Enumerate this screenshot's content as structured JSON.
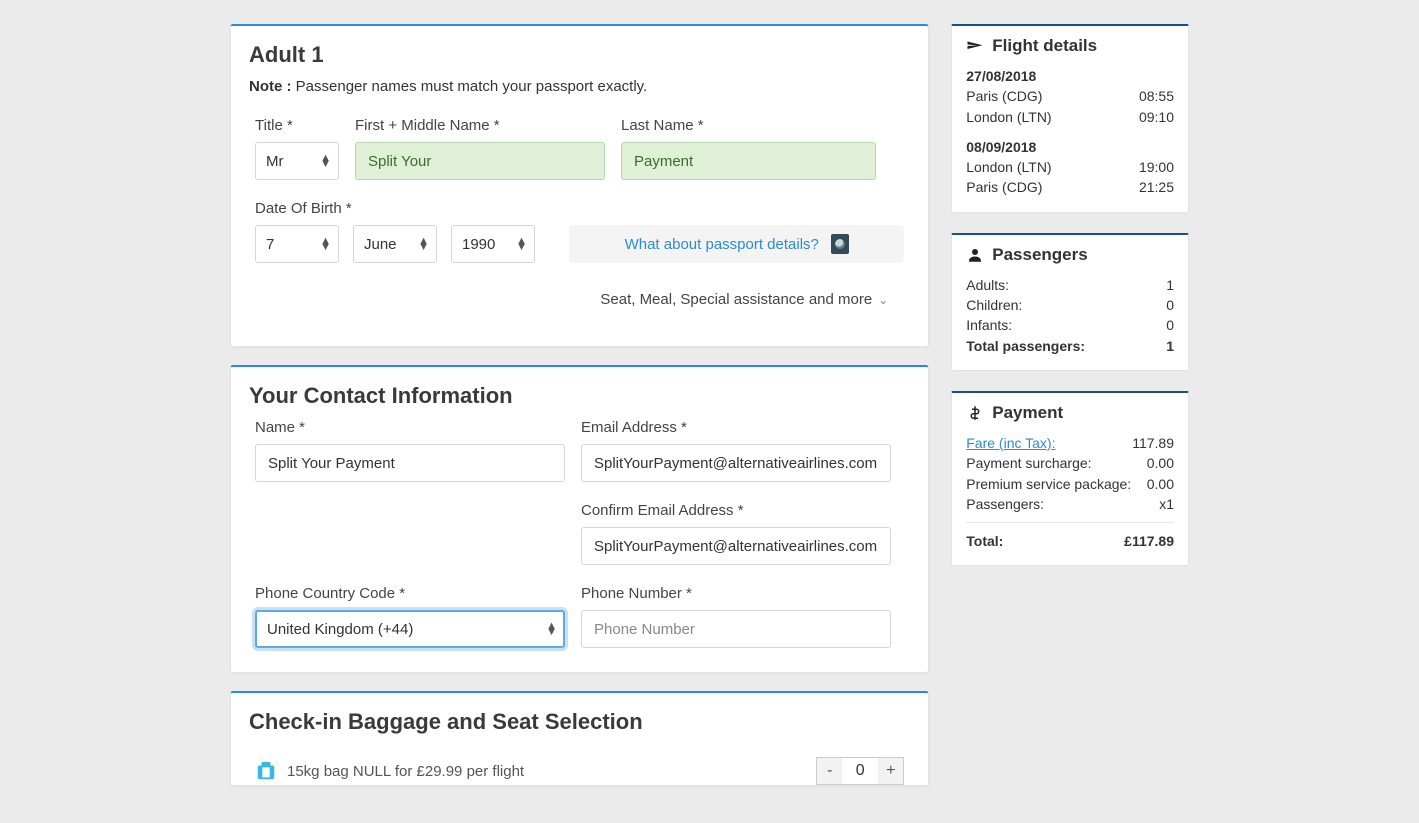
{
  "adult": {
    "heading": "Adult 1",
    "note_label": "Note :",
    "note_text": "Passenger names must match your passport exactly.",
    "title_label": "Title *",
    "title_value": "Mr",
    "first_label": "First + Middle Name *",
    "first_value": "Split Your",
    "last_label": "Last Name *",
    "last_value": "Payment",
    "dob_label": "Date Of Birth *",
    "dob_day": "7",
    "dob_month": "June",
    "dob_year": "1990",
    "passport_link": "What about passport details?",
    "expander": "Seat, Meal, Special assistance and more"
  },
  "contact": {
    "heading": "Your Contact Information",
    "name_label": "Name *",
    "name_value": "Split Your Payment",
    "email_label": "Email Address *",
    "email_value": "SplitYourPayment@alternativeairlines.com",
    "confirm_label": "Confirm Email Address *",
    "confirm_value": "SplitYourPayment@alternativeairlines.com",
    "code_label": "Phone Country Code *",
    "code_value": "United Kingdom (+44)",
    "phone_label": "Phone Number *",
    "phone_placeholder": "Phone Number"
  },
  "baggage": {
    "heading": "Check-in Baggage and Seat Selection",
    "item_text": "15kg bag NULL for £29.99 per flight",
    "count": "0"
  },
  "flight": {
    "heading": "Flight details",
    "out_date": "27/08/2018",
    "out_from": "Paris (CDG)",
    "out_from_time": "08:55",
    "out_to": "London (LTN)",
    "out_to_time": "09:10",
    "ret_date": "08/09/2018",
    "ret_from": "London (LTN)",
    "ret_from_time": "19:00",
    "ret_to": "Paris (CDG)",
    "ret_to_time": "21:25"
  },
  "passengers": {
    "heading": "Passengers",
    "adults_label": "Adults:",
    "adults_val": "1",
    "children_label": "Children:",
    "children_val": "0",
    "infants_label": "Infants:",
    "infants_val": "0",
    "total_label": "Total passengers:",
    "total_val": "1"
  },
  "payment": {
    "heading": "Payment",
    "fare_label": "Fare (inc Tax):",
    "fare_val": "117.89",
    "surcharge_label": "Payment surcharge:",
    "surcharge_val": "0.00",
    "premium_label": "Premium service package:",
    "premium_val": "0.00",
    "pax_label": "Passengers:",
    "pax_val": "x1",
    "total_label": "Total:",
    "total_val": "£117.89"
  }
}
